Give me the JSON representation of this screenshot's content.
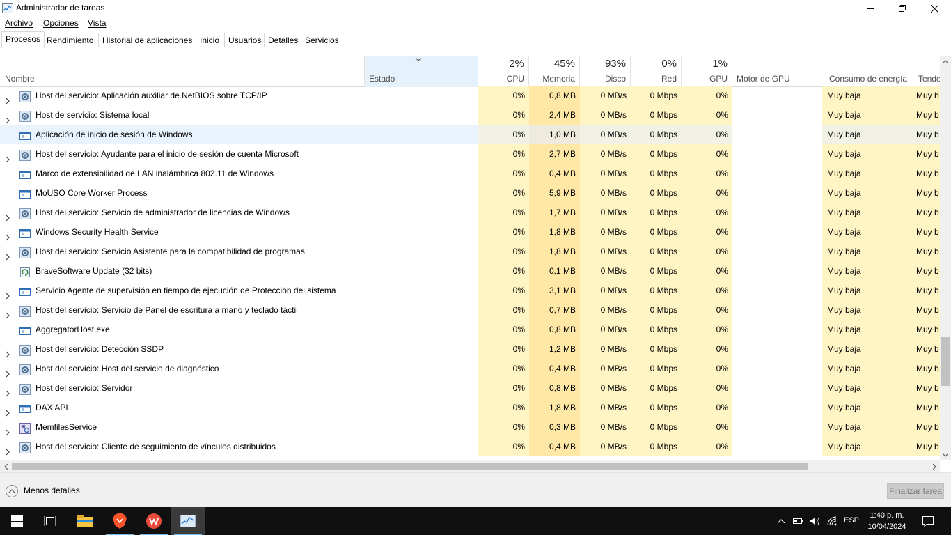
{
  "window": {
    "title": "Administrador de tareas"
  },
  "menu": {
    "file": "Archivo",
    "options": "Opciones",
    "view": "Vista"
  },
  "tabs": [
    {
      "label": "Procesos"
    },
    {
      "label": "Rendimiento"
    },
    {
      "label": "Historial de aplicaciones"
    },
    {
      "label": "Inicio"
    },
    {
      "label": "Usuarios"
    },
    {
      "label": "Detalles"
    },
    {
      "label": "Servicios"
    }
  ],
  "columns": {
    "name": "Nombre",
    "status": "Estado",
    "cpu": {
      "label": "CPU",
      "pct": "2%"
    },
    "memory": {
      "label": "Memoria",
      "pct": "45%"
    },
    "disk": {
      "label": "Disco",
      "pct": "93%"
    },
    "network": {
      "label": "Red",
      "pct": "0%"
    },
    "gpu": {
      "label": "GPU",
      "pct": "1%"
    },
    "gpu_engine": "Motor de GPU",
    "power": "Consumo de energía",
    "power_trend": "Tendenci"
  },
  "rows": [
    {
      "name": "Host del servicio: Aplicación auxiliar de NetBIOS sobre TCP/IP",
      "expandable": true,
      "icon": "gear-icon",
      "cpu": "0%",
      "mem": "0,8 MB",
      "disk": "0 MB/s",
      "net": "0 Mbps",
      "gpu": "0%",
      "power": "Muy baja",
      "trend": "Muy b"
    },
    {
      "name": "Host de servicio: Sistema local",
      "expandable": true,
      "icon": "gear-icon",
      "cpu": "0%",
      "mem": "2,4 MB",
      "disk": "0 MB/s",
      "net": "0 Mbps",
      "gpu": "0%",
      "power": "Muy baja",
      "trend": "Muy b"
    },
    {
      "name": "Aplicación de inicio de sesión de Windows",
      "expandable": false,
      "icon": "window-app-icon",
      "selected": true,
      "cpu": "0%",
      "mem": "1,0 MB",
      "disk": "0 MB/s",
      "net": "0 Mbps",
      "gpu": "0%",
      "power": "Muy baja",
      "trend": "Muy b"
    },
    {
      "name": "Host del servicio: Ayudante para el inicio de sesión de cuenta Microsoft",
      "expandable": true,
      "icon": "gear-icon",
      "cpu": "0%",
      "mem": "2,7 MB",
      "disk": "0 MB/s",
      "net": "0 Mbps",
      "gpu": "0%",
      "power": "Muy baja",
      "trend": "Muy b"
    },
    {
      "name": "Marco de extensibilidad de LAN inalámbrica 802.11 de Windows",
      "expandable": false,
      "icon": "window-app-icon",
      "cpu": "0%",
      "mem": "0,4 MB",
      "disk": "0 MB/s",
      "net": "0 Mbps",
      "gpu": "0%",
      "power": "Muy baja",
      "trend": "Muy b"
    },
    {
      "name": "MoUSO Core Worker Process",
      "expandable": false,
      "icon": "window-app-icon",
      "cpu": "0%",
      "mem": "5,9 MB",
      "disk": "0 MB/s",
      "net": "0 Mbps",
      "gpu": "0%",
      "power": "Muy baja",
      "trend": "Muy b"
    },
    {
      "name": "Host del servicio: Servicio de administrador de licencias de Windows",
      "expandable": true,
      "icon": "gear-icon",
      "cpu": "0%",
      "mem": "1,7 MB",
      "disk": "0 MB/s",
      "net": "0 Mbps",
      "gpu": "0%",
      "power": "Muy baja",
      "trend": "Muy b"
    },
    {
      "name": "Windows Security Health Service",
      "expandable": true,
      "icon": "window-app-icon",
      "cpu": "0%",
      "mem": "1,8 MB",
      "disk": "0 MB/s",
      "net": "0 Mbps",
      "gpu": "0%",
      "power": "Muy baja",
      "trend": "Muy b"
    },
    {
      "name": "Host del servicio: Servicio Asistente para la compatibilidad de programas",
      "expandable": true,
      "icon": "gear-icon",
      "cpu": "0%",
      "mem": "1,8 MB",
      "disk": "0 MB/s",
      "net": "0 Mbps",
      "gpu": "0%",
      "power": "Muy baja",
      "trend": "Muy b"
    },
    {
      "name": "BraveSoftware Update (32 bits)",
      "expandable": false,
      "icon": "update-icon",
      "cpu": "0%",
      "mem": "0,1 MB",
      "disk": "0 MB/s",
      "net": "0 Mbps",
      "gpu": "0%",
      "power": "Muy baja",
      "trend": "Muy b"
    },
    {
      "name": "Servicio Agente de supervisión en tiempo de ejecución de Protección del sistema",
      "expandable": true,
      "icon": "window-app-icon",
      "cpu": "0%",
      "mem": "3,1 MB",
      "disk": "0 MB/s",
      "net": "0 Mbps",
      "gpu": "0%",
      "power": "Muy baja",
      "trend": "Muy b"
    },
    {
      "name": "Host del servicio: Servicio de Panel de escritura a mano y teclado táctil",
      "expandable": true,
      "icon": "gear-icon",
      "cpu": "0%",
      "mem": "0,7 MB",
      "disk": "0 MB/s",
      "net": "0 Mbps",
      "gpu": "0%",
      "power": "Muy baja",
      "trend": "Muy b"
    },
    {
      "name": "AggregatorHost.exe",
      "expandable": false,
      "icon": "window-app-icon",
      "cpu": "0%",
      "mem": "0,8 MB",
      "disk": "0 MB/s",
      "net": "0 Mbps",
      "gpu": "0%",
      "power": "Muy baja",
      "trend": "Muy b"
    },
    {
      "name": "Host del servicio: Detección SSDP",
      "expandable": true,
      "icon": "gear-icon",
      "cpu": "0%",
      "mem": "1,2 MB",
      "disk": "0 MB/s",
      "net": "0 Mbps",
      "gpu": "0%",
      "power": "Muy baja",
      "trend": "Muy b"
    },
    {
      "name": "Host del servicio: Host del servicio de diagnóstico",
      "expandable": true,
      "icon": "gear-icon",
      "cpu": "0%",
      "mem": "0,4 MB",
      "disk": "0 MB/s",
      "net": "0 Mbps",
      "gpu": "0%",
      "power": "Muy baja",
      "trend": "Muy b"
    },
    {
      "name": "Host del servicio: Servidor",
      "expandable": true,
      "icon": "gear-icon",
      "cpu": "0%",
      "mem": "0,8 MB",
      "disk": "0 MB/s",
      "net": "0 Mbps",
      "gpu": "0%",
      "power": "Muy baja",
      "trend": "Muy b"
    },
    {
      "name": "DAX API",
      "expandable": true,
      "icon": "window-app-icon",
      "cpu": "0%",
      "mem": "1,8 MB",
      "disk": "0 MB/s",
      "net": "0 Mbps",
      "gpu": "0%",
      "power": "Muy baja",
      "trend": "Muy b"
    },
    {
      "name": "MemfilesService",
      "expandable": true,
      "icon": "service-app-icon",
      "cpu": "0%",
      "mem": "0,3 MB",
      "disk": "0 MB/s",
      "net": "0 Mbps",
      "gpu": "0%",
      "power": "Muy baja",
      "trend": "Muy b"
    },
    {
      "name": "Host del servicio: Cliente de seguimiento de vínculos distribuidos",
      "expandable": true,
      "icon": "gear-icon",
      "cpu": "0%",
      "mem": "0,4 MB",
      "disk": "0 MB/s",
      "net": "0 Mbps",
      "gpu": "0%",
      "power": "Muy baja",
      "trend": "Muy b"
    }
  ],
  "footer": {
    "less_details": "Menos detalles",
    "end_task": "Finalizar tarea"
  },
  "taskbar": {
    "language": "ESP",
    "time": "1:40 p. m.",
    "date": "10/04/2024",
    "apps": [
      "start-icon",
      "task-view-icon",
      "file-explorer-icon",
      "brave-browser-icon",
      "wps-office-icon",
      "task-manager-icon"
    ]
  },
  "colors": {
    "heat_light": "#fff4c4",
    "heat_mem": "#ffe8a6",
    "selection": "#e9f3fd",
    "taskbar": "#101010",
    "accent": "#76b9ed"
  }
}
